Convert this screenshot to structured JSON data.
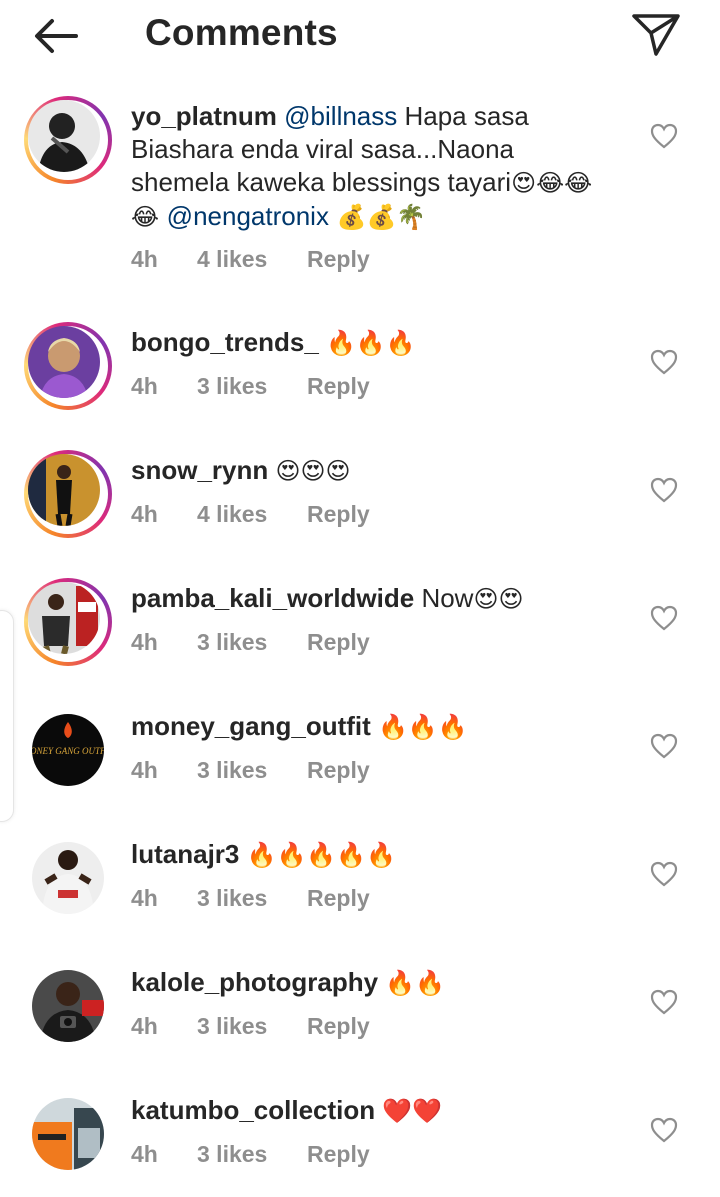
{
  "header": {
    "title": "Comments",
    "back_icon": "arrow-left-icon",
    "send_icon": "paper-plane-icon"
  },
  "comments": [
    {
      "user": "yo_platnum",
      "mention": "@billnass",
      "text1": " Hapa sasa Biashara enda viral sasa...Naona shemela kaweka blessings tayari",
      "emoji1": "😍😂😂😂 ",
      "mention2": "@nengatronix",
      "emoji2": " 💰💰🌴",
      "time": "4h",
      "likes": "4 likes",
      "reply": "Reply"
    },
    {
      "user": "bongo_trends_",
      "text": " ",
      "emoji": "🔥🔥🔥",
      "time": "4h",
      "likes": "3 likes",
      "reply": "Reply"
    },
    {
      "user": "snow_rynn",
      "text": " ",
      "emoji": "😍😍😍",
      "time": "4h",
      "likes": "4 likes",
      "reply": "Reply"
    },
    {
      "user": "pamba_kali_worldwide",
      "text": " Now",
      "emoji": "😍😍",
      "time": "4h",
      "likes": "3 likes",
      "reply": "Reply"
    },
    {
      "user": "money_gang_outfit",
      "text": " ",
      "emoji": "🔥🔥🔥",
      "time": "4h",
      "likes": "3 likes",
      "reply": "Reply"
    },
    {
      "user": "lutanajr3",
      "text": " ",
      "emoji": "🔥🔥🔥🔥🔥",
      "time": "4h",
      "likes": "3 likes",
      "reply": "Reply"
    },
    {
      "user": "kalole_photography",
      "text": " ",
      "emoji": "🔥🔥",
      "time": "4h",
      "likes": "3 likes",
      "reply": "Reply"
    },
    {
      "user": "katumbo_collection",
      "text": " ",
      "emoji": "❤️❤️",
      "time": "4h",
      "likes": "3 likes",
      "reply": "Reply"
    }
  ],
  "avatar_texts": {
    "money_gang": "MONEY GANG OUTFIT"
  },
  "colors": {
    "mention": "#00376b",
    "meta": "#8e8e8e",
    "text": "#262626"
  }
}
